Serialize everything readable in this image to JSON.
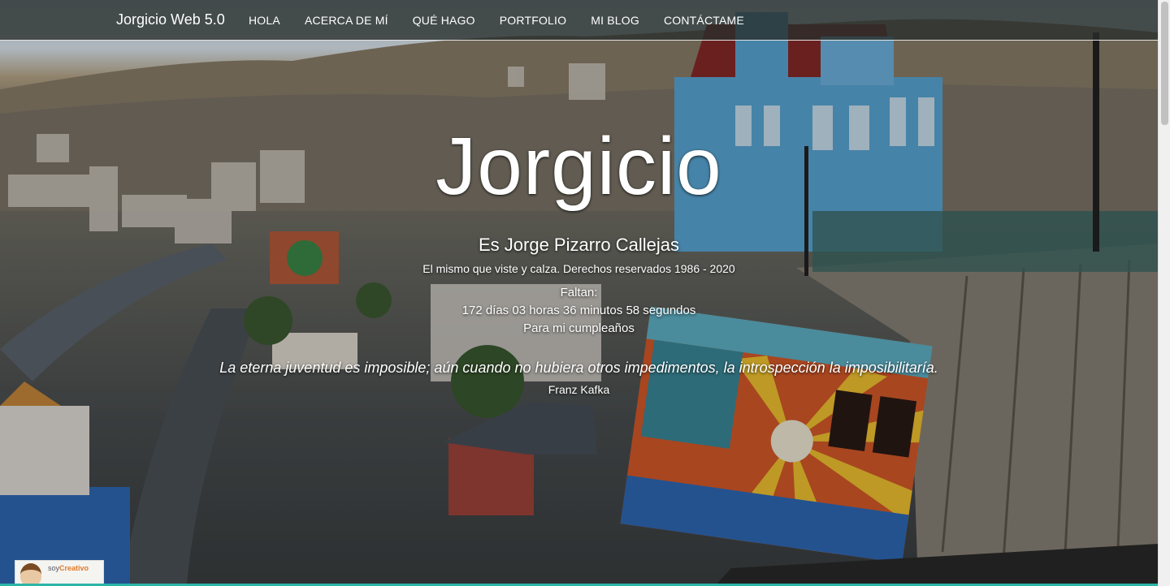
{
  "navbar": {
    "brand": "Jorgicio Web 5.0",
    "items": [
      {
        "label": "HOLA"
      },
      {
        "label": "ACERCA DE MÍ"
      },
      {
        "label": "QUÉ HAGO"
      },
      {
        "label": "PORTFOLIO"
      },
      {
        "label": "MI BLOG"
      },
      {
        "label": "CONTÁCTAME"
      }
    ]
  },
  "hero": {
    "title": "Jorgicio",
    "subtitle": "Es Jorge Pizarro Callejas",
    "tagline": "El mismo que viste y calza. Derechos reservados 1986 - 2020",
    "countdown_label": "Faltan:",
    "countdown": "172 días 03 horas 36 minutos 58 segundos",
    "countdown_suffix": "Para mi cumpleaños",
    "quote": "La eterna juventud es imposible; aún cuando no hubiera otros impedimentos, la introspección la imposibilitaría.",
    "quote_author": "Franz Kafka"
  },
  "badge": {
    "text_prefix": "soy",
    "text_main": "Creativo"
  },
  "colors": {
    "navbar_bg": "#2c3230",
    "accent_bottom": "#2bb5a8",
    "house_blue": "#5aa8d8",
    "roof_red": "#8a2a2a"
  }
}
